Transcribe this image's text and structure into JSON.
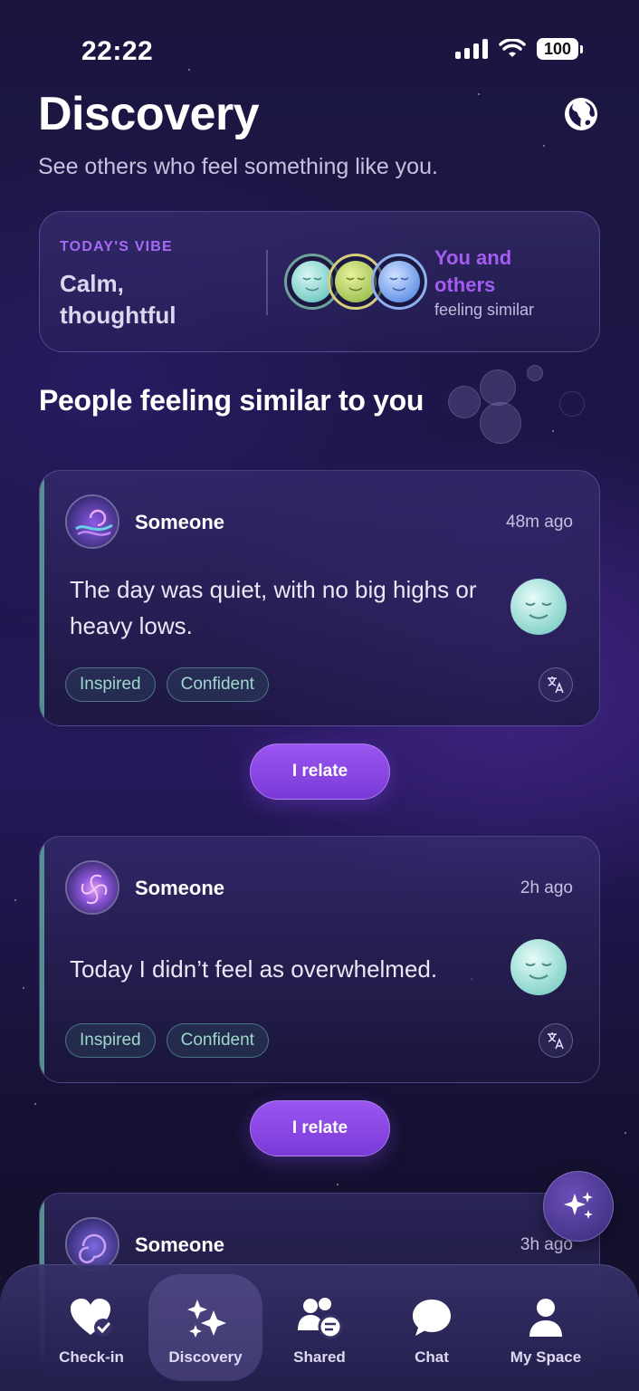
{
  "status_bar": {
    "time": "22:22",
    "battery": "100"
  },
  "header": {
    "title": "Discovery",
    "subtitle": "See others who feel something like you."
  },
  "vibe": {
    "label": "TODAY'S VIBE",
    "value": "Calm, thoughtful",
    "others_title": "You and others",
    "others_subtitle": "feeling similar"
  },
  "section": {
    "title": "People feeling similar to you"
  },
  "posts": [
    {
      "author": "Someone",
      "time": "48m ago",
      "text": "The day was quiet, with no big highs or heavy lows.",
      "tags": [
        "Inspired",
        "Confident"
      ],
      "relate_label": "I relate"
    },
    {
      "author": "Someone",
      "time": "2h ago",
      "text": "Today I didn’t feel as overwhelmed.",
      "tags": [
        "Inspired",
        "Confident"
      ],
      "relate_label": "I relate"
    },
    {
      "author": "Someone",
      "time": "3h ago"
    }
  ],
  "nav": {
    "items": [
      {
        "label": "Check-in",
        "icon": "heart-check-icon"
      },
      {
        "label": "Discovery",
        "icon": "sparkles-icon",
        "active": true
      },
      {
        "label": "Shared",
        "icon": "people-chat-icon"
      },
      {
        "label": "Chat",
        "icon": "chat-bubble-icon"
      },
      {
        "label": "My Space",
        "icon": "person-icon"
      }
    ]
  },
  "colors": {
    "accent_purple": "#a45cf2",
    "tag_teal": "#9fd6cc",
    "background": "#1d1547"
  }
}
